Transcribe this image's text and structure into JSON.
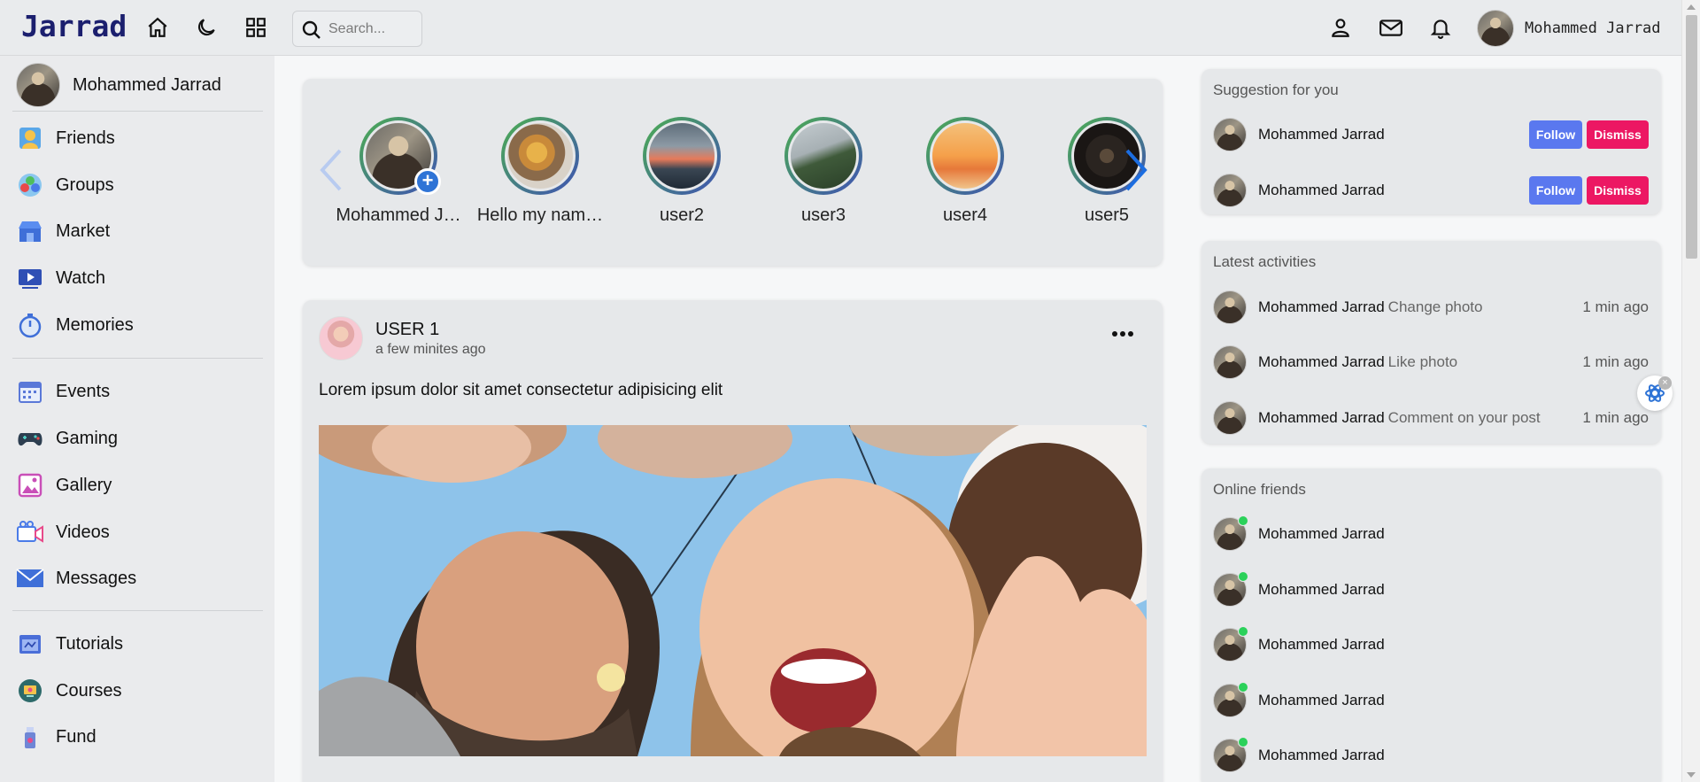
{
  "header": {
    "logo": "Jarrad",
    "search_placeholder": "Search...",
    "user_name": "Mohammed Jarrad",
    "icons": [
      "home-icon",
      "moon-icon",
      "grid-icon",
      "search-icon",
      "person-icon",
      "mail-icon",
      "bell-icon"
    ]
  },
  "sidebar": {
    "user_name": "Mohammed Jarrad",
    "items": [
      {
        "label": "Friends",
        "icon": "friends-icon"
      },
      {
        "label": "Groups",
        "icon": "groups-icon"
      },
      {
        "label": "Market",
        "icon": "market-icon"
      },
      {
        "label": "Watch",
        "icon": "watch-icon"
      },
      {
        "label": "Memories",
        "icon": "memories-icon"
      },
      {
        "label": "Events",
        "icon": "events-icon"
      },
      {
        "label": "Gaming",
        "icon": "gaming-icon"
      },
      {
        "label": "Gallery",
        "icon": "gallery-icon"
      },
      {
        "label": "Videos",
        "icon": "videos-icon"
      },
      {
        "label": "Messages",
        "icon": "messages-icon"
      },
      {
        "label": "Tutorials",
        "icon": "tutorials-icon"
      },
      {
        "label": "Courses",
        "icon": "courses-icon"
      },
      {
        "label": "Fund",
        "icon": "fund-icon"
      }
    ]
  },
  "stories": [
    {
      "name": "Mohammed J…",
      "add": "+"
    },
    {
      "name": "Hello my nam…"
    },
    {
      "name": "user2"
    },
    {
      "name": "user3"
    },
    {
      "name": "user4"
    },
    {
      "name": "user5"
    }
  ],
  "post": {
    "user": "USER 1",
    "time": "a few minites ago",
    "text": "Lorem ipsum dolor sit amet consectetur adipisicing elit"
  },
  "suggestions": {
    "title": "Suggestion for you",
    "items": [
      {
        "name": "Mohammed Jarrad",
        "follow": "Follow",
        "dismiss": "Dismiss"
      },
      {
        "name": "Mohammed Jarrad",
        "follow": "Follow",
        "dismiss": "Dismiss"
      }
    ]
  },
  "activities": {
    "title": "Latest activities",
    "items": [
      {
        "name": "Mohammed Jarrad",
        "action": "Change photo",
        "time": "1 min ago"
      },
      {
        "name": "Mohammed Jarrad",
        "action": "Like photo",
        "time": "1 min ago"
      },
      {
        "name": "Mohammed Jarrad",
        "action": "Comment on your post",
        "time": "1 min ago"
      }
    ]
  },
  "online": {
    "title": "Online friends",
    "items": [
      {
        "name": "Mohammed Jarrad"
      },
      {
        "name": "Mohammed Jarrad"
      },
      {
        "name": "Mohammed Jarrad"
      },
      {
        "name": "Mohammed Jarrad"
      },
      {
        "name": "Mohammed Jarrad"
      }
    ]
  },
  "floating": {
    "close": "×"
  },
  "colors": {
    "follow": "#5a78ef",
    "dismiss": "#ec1763",
    "online": "#2bd15a",
    "logo": "#1b1f6e",
    "story_add": "#2f74d6"
  }
}
